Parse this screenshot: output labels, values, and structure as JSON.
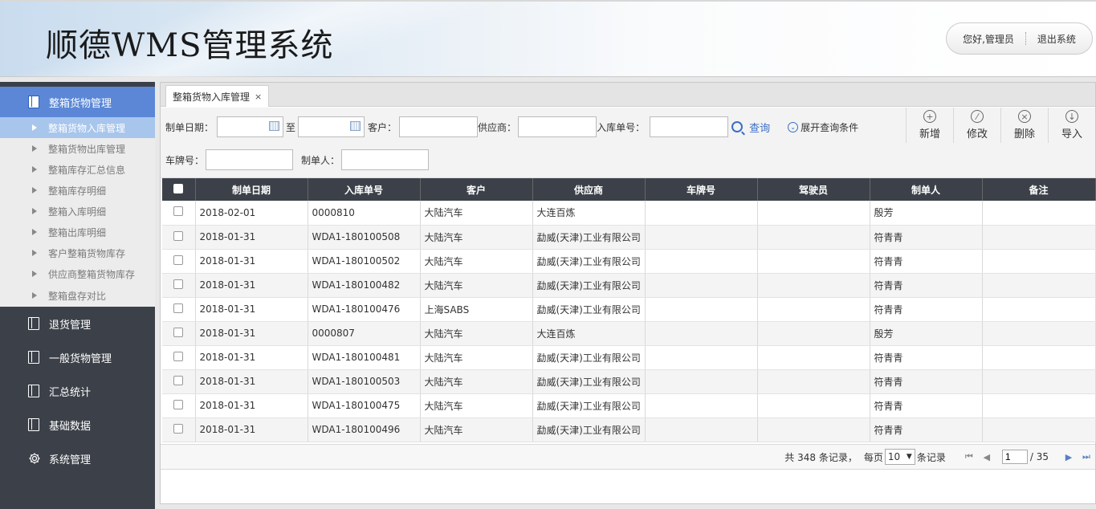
{
  "header": {
    "title": "顺德WMS管理系统",
    "greeting": "您好,管理员",
    "logout": "退出系统"
  },
  "sidebar": {
    "active_group": "整箱货物管理",
    "sub_items": [
      "整箱货物入库管理",
      "整箱货物出库管理",
      "整箱库存汇总信息",
      "整箱库存明细",
      "整箱入库明细",
      "整箱出库明细",
      "客户整箱货物库存",
      "供应商整箱货物库存",
      "整箱盘存对比"
    ],
    "groups": [
      "退货管理",
      "一般货物管理",
      "汇总统计",
      "基础数据",
      "系统管理"
    ]
  },
  "tab": {
    "label": "整箱货物入库管理",
    "close": "×"
  },
  "filters": {
    "date_label": "制单日期：",
    "to_label": "至",
    "customer_label": "客户：",
    "supplier_label": "供应商：",
    "order_label": "入库单号：",
    "query": "查询",
    "expand": "展开查询条件",
    "plate_label": "车牌号：",
    "creator_label": "制单人："
  },
  "actions": {
    "add": "新增",
    "edit": "修改",
    "delete": "删除",
    "import": "导入"
  },
  "table": {
    "columns": [
      "制单日期",
      "入库单号",
      "客户",
      "供应商",
      "车牌号",
      "驾驶员",
      "制单人",
      "备注"
    ],
    "rows": [
      [
        "2018-02-01",
        "0000810",
        "大陆汽车",
        "大连百炼",
        "",
        "",
        "殷芳",
        ""
      ],
      [
        "2018-01-31",
        "WDA1-180100508",
        "大陆汽车",
        "勐威(天津)工业有限公司",
        "",
        "",
        "符青青",
        ""
      ],
      [
        "2018-01-31",
        "WDA1-180100502",
        "大陆汽车",
        "勐威(天津)工业有限公司",
        "",
        "",
        "符青青",
        ""
      ],
      [
        "2018-01-31",
        "WDA1-180100482",
        "大陆汽车",
        "勐威(天津)工业有限公司",
        "",
        "",
        "符青青",
        ""
      ],
      [
        "2018-01-31",
        "WDA1-180100476",
        "上海SABS",
        "勐威(天津)工业有限公司",
        "",
        "",
        "符青青",
        ""
      ],
      [
        "2018-01-31",
        "0000807",
        "大陆汽车",
        "大连百炼",
        "",
        "",
        "殷芳",
        ""
      ],
      [
        "2018-01-31",
        "WDA1-180100481",
        "大陆汽车",
        "勐威(天津)工业有限公司",
        "",
        "",
        "符青青",
        ""
      ],
      [
        "2018-01-31",
        "WDA1-180100503",
        "大陆汽车",
        "勐威(天津)工业有限公司",
        "",
        "",
        "符青青",
        ""
      ],
      [
        "2018-01-31",
        "WDA1-180100475",
        "大陆汽车",
        "勐威(天津)工业有限公司",
        "",
        "",
        "符青青",
        ""
      ],
      [
        "2018-01-31",
        "WDA1-180100496",
        "大陆汽车",
        "勐威(天津)工业有限公司",
        "",
        "",
        "符青青",
        ""
      ]
    ]
  },
  "pager": {
    "total_text": "共 348 条记录，",
    "per_page_label": "每页",
    "per_page": "10",
    "records_label": "条记录",
    "current_page": "1",
    "total_pages": "/ 35"
  },
  "colors": {
    "sidebar_bg": "#3c4149",
    "active_blue": "#5b87d6",
    "link": "#4a6ea8"
  }
}
